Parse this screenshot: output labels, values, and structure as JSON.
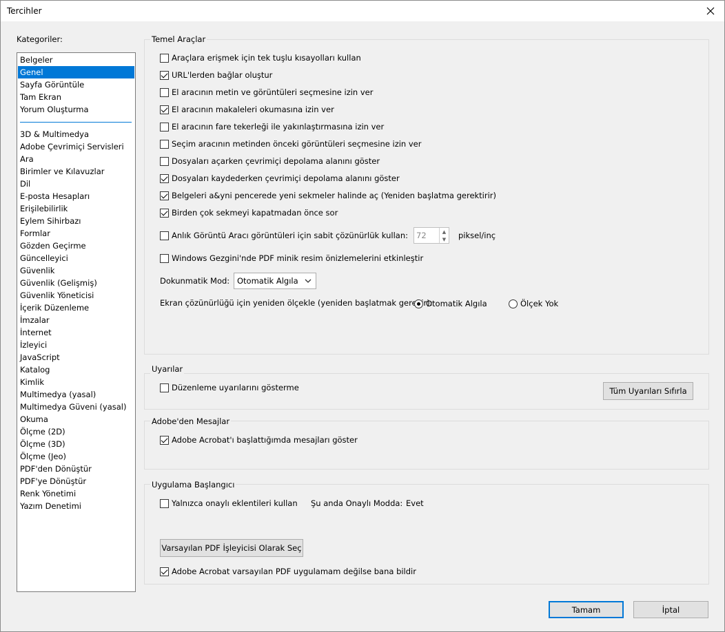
{
  "window": {
    "title": "Tercihler"
  },
  "categories": {
    "label": "Kategoriler:",
    "top_items": [
      "Belgeler",
      "Genel",
      "Sayfa Görüntüle",
      "Tam Ekran",
      "Yorum Oluşturma"
    ],
    "selected": "Genel",
    "items": [
      "3D & Multimedya",
      "Adobe Çevrimiçi Servisleri",
      "Ara",
      "Birimler ve Kılavuzlar",
      "Dil",
      "E-posta Hesapları",
      "Erişilebilirlik",
      "Eylem Sihirbazı",
      "Formlar",
      "Gözden Geçirme",
      "Güncelleyici",
      "Güvenlik",
      "Güvenlik (Gelişmiş)",
      "Güvenlik Yöneticisi",
      "İçerik Düzenleme",
      "İmzalar",
      "İnternet",
      "İzleyici",
      "JavaScript",
      "Katalog",
      "Kimlik",
      "Multimedya (yasal)",
      "Multimedya Güveni (yasal)",
      "Okuma",
      "Ölçme (2D)",
      "Ölçme (3D)",
      "Ölçme (Jeo)",
      "PDF'den Dönüştür",
      "PDF'ye Dönüştür",
      "Renk Yönetimi",
      "Yazım Denetimi"
    ]
  },
  "temel": {
    "title": "Temel Araçlar",
    "options": [
      {
        "label": "Araçlara erişmek için tek tuşlu kısayolları kullan",
        "checked": false
      },
      {
        "label": "URL'lerden bağlar oluştur",
        "checked": true
      },
      {
        "label": "El aracının metin ve görüntüleri seçmesine izin ver",
        "checked": false
      },
      {
        "label": "El aracının makaleleri okumasına izin ver",
        "checked": true
      },
      {
        "label": "El aracının fare tekerleği ile yakınlaştırmasına izin ver",
        "checked": false
      },
      {
        "label": "Seçim aracının metinden önceki görüntüleri seçmesine izin ver",
        "checked": false
      },
      {
        "label": "Dosyaları açarken çevrimiçi depolama alanını göster",
        "checked": false
      },
      {
        "label": "Dosyaları kaydederken çevrimiçi depolama alanını göster",
        "checked": true
      },
      {
        "label": "Belgeleri a&yni pencerede yeni sekmeler halinde aç (Yeniden başlatma gerektirir)",
        "checked": true
      },
      {
        "label": "Birden çok sekmeyi kapatmadan önce sor",
        "checked": true
      }
    ],
    "snapshot": {
      "label": "Anlık Görüntü Aracı görüntüleri için sabit çözünürlük kullan:",
      "checked": false,
      "value": "72",
      "unit": "piksel/inç"
    },
    "explorer": {
      "label": "Windows Gezgini'nde PDF minik resim önizlemelerini etkinleştir",
      "checked": false
    },
    "touch": {
      "label": "Dokunmatik Mod:",
      "value": "Otomatik Algıla"
    },
    "scale": {
      "label": "Ekran çözünürlüğü için yeniden ölçekle (yeniden başlatmak gerekir):",
      "options": [
        "Otomatik Algıla",
        "Ölçek Yok"
      ],
      "selected": "Otomatik Algıla"
    }
  },
  "warnings": {
    "title": "Uyarılar",
    "option": {
      "label": "Düzenleme uyarılarını gösterme",
      "checked": false
    },
    "reset_button": "Tüm Uyarıları Sıfırla"
  },
  "messages": {
    "title": "Adobe'den Mesajlar",
    "option": {
      "label": "Adobe Acrobat'ı başlattığımda mesajları göster",
      "checked": true
    }
  },
  "startup": {
    "title": "Uygulama Başlangıcı",
    "option": {
      "label": "Yalnızca onaylı eklentileri kullan",
      "checked": false
    },
    "mode_label": "Şu anda Onaylı Modda:",
    "mode_value": "Evet",
    "default_button": "Varsayılan PDF İşleyicisi Olarak Seç",
    "notify": {
      "label": "Adobe Acrobat varsayılan PDF uygulamam değilse bana bildir",
      "checked": true
    }
  },
  "footer": {
    "ok": "Tamam",
    "cancel": "İptal"
  }
}
